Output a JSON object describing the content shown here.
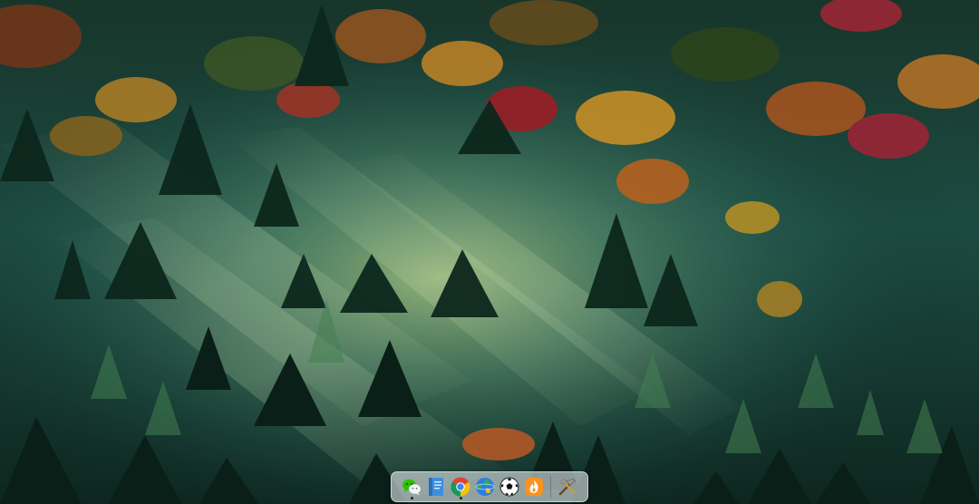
{
  "desktop": {
    "wallpaper_icon": "misty-autumn-forest-wallpaper"
  },
  "dock": {
    "items": [
      {
        "icon": "wechat-icon",
        "color": "#2dc100",
        "running": true
      },
      {
        "icon": "notes-app-icon",
        "color": "#3b8fe0",
        "running": false
      },
      {
        "icon": "chrome-icon",
        "color": "#db4437",
        "running": true
      },
      {
        "icon": "maps-globe-icon",
        "color": "#34a853",
        "running": false
      },
      {
        "icon": "soccer-ball-icon",
        "color": "#ffffff",
        "running": false
      },
      {
        "icon": "flame-app-icon",
        "color": "#f7931e",
        "running": false
      },
      {
        "icon": "tools-icon",
        "color": "#c0c0c0",
        "running": false
      }
    ],
    "accent": "#e1e8ec"
  }
}
